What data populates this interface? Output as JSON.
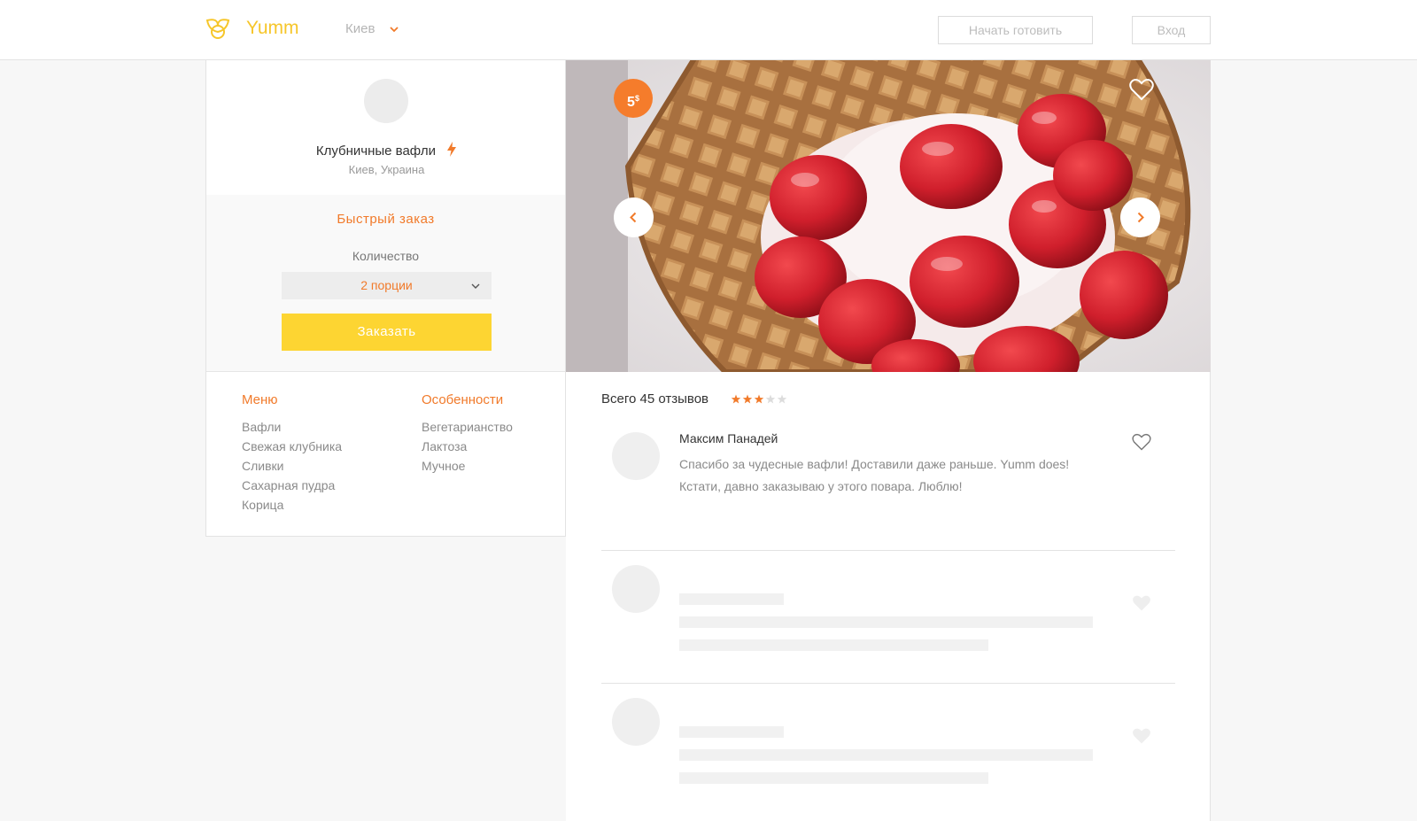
{
  "header": {
    "brand": "Yumm",
    "city": "Киев",
    "start_cooking": "Начать готовить",
    "login": "Вход"
  },
  "dish": {
    "title": "Клубничные вафли",
    "location": "Киев, Украина",
    "price": "5",
    "currency": "$"
  },
  "order": {
    "title": "Быстрый заказ",
    "quantity_label": "Количество",
    "quantity_value": "2 порции",
    "order_button": "Заказать"
  },
  "menu": {
    "title": "Меню",
    "items": [
      "Вафли",
      "Свежая клубника",
      "Сливки",
      "Сахарная пудра",
      "Корица"
    ]
  },
  "features": {
    "title": "Особенности",
    "items": [
      "Вегетарианство",
      "Лактоза",
      "Мучное"
    ]
  },
  "reviews": {
    "summary": "Всего 45 отзывов",
    "rating": 3,
    "rating_max": 5,
    "items": [
      {
        "name": "Максим Панадей",
        "text": "Спасибо за чудесные вафли! Доставили даже раньше. Yumm does! Кстати, давно заказываю у этого повара. Люблю!"
      }
    ]
  },
  "colors": {
    "accent_orange": "#f17a2a",
    "accent_yellow": "#fdd532",
    "brand_yellow": "#f6c62a"
  }
}
